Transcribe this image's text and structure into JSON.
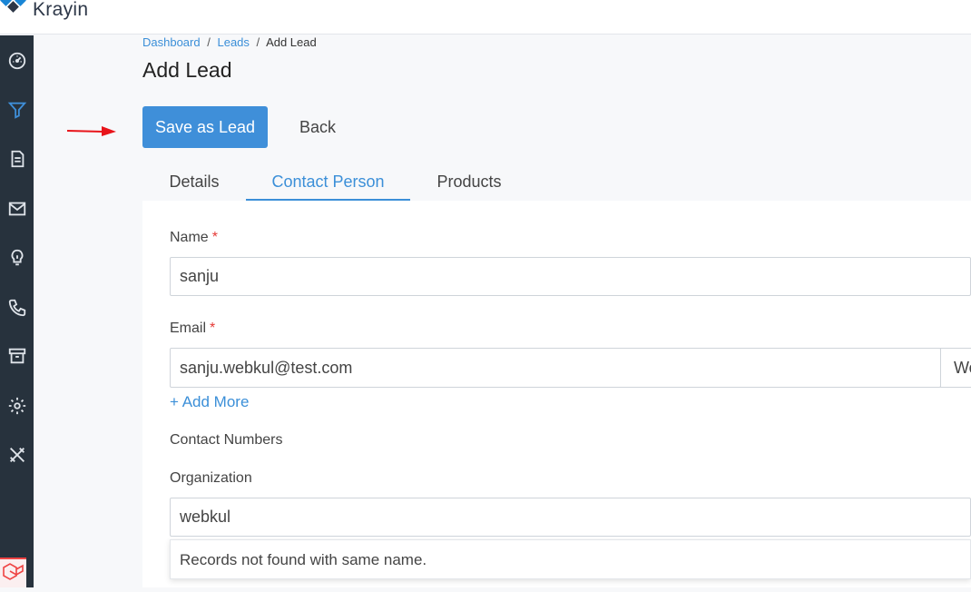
{
  "app": {
    "brand": "Krayin"
  },
  "sidebar": {
    "items": [
      {
        "icon": "dashboard-icon",
        "active": false
      },
      {
        "icon": "filter-icon",
        "active": true
      },
      {
        "icon": "quote-icon",
        "active": false
      },
      {
        "icon": "mail-icon",
        "active": false
      },
      {
        "icon": "lightbulb-icon",
        "active": false
      },
      {
        "icon": "phone-icon",
        "active": false
      },
      {
        "icon": "archive-icon",
        "active": false
      },
      {
        "icon": "settings-icon",
        "active": false
      },
      {
        "icon": "tools-icon",
        "active": false
      }
    ]
  },
  "breadcrumb": {
    "dashboard": "Dashboard",
    "sep": "/",
    "leads": "Leads",
    "current": "Add Lead"
  },
  "page": {
    "title": "Add Lead"
  },
  "actions": {
    "save": "Save as Lead",
    "back": "Back"
  },
  "tabs": [
    {
      "label": "Details",
      "active": false
    },
    {
      "label": "Contact Person",
      "active": true
    },
    {
      "label": "Products",
      "active": false
    }
  ],
  "form": {
    "name": {
      "label": "Name",
      "required": "*",
      "value": "sanju"
    },
    "email": {
      "label": "Email",
      "required": "*",
      "value": "sanju.webkul@test.com",
      "type_value": "Work"
    },
    "add_more": "+ Add More",
    "contact_numbers": {
      "label": "Contact Numbers"
    },
    "organization": {
      "label": "Organization",
      "value": "webkul",
      "suggestion": "Records not found with same name."
    }
  },
  "colors": {
    "accent": "#3f8fd9",
    "sidebar": "#27323d",
    "required": "#e53935",
    "arrow": "#e8141a"
  }
}
